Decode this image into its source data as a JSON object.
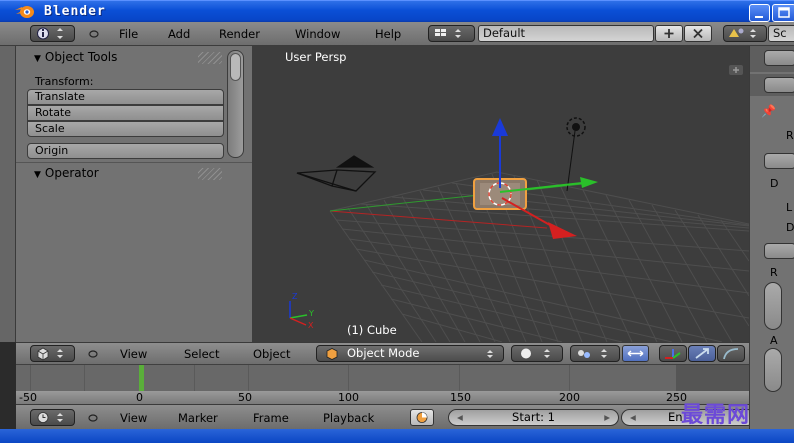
{
  "window": {
    "title": "Blender"
  },
  "info_header": {
    "menus": [
      "File",
      "Add",
      "Render",
      "Window",
      "Help"
    ],
    "screen_layout": "Default",
    "scene": "Sc"
  },
  "toolshelf": {
    "object_tools_title": "Object Tools",
    "transform_label": "Transform:",
    "buttons": [
      "Translate",
      "Rotate",
      "Scale"
    ],
    "origin_button": "Origin",
    "operator_title": "Operator"
  },
  "viewport": {
    "view_label": "User Persp",
    "object_label": "(1) Cube"
  },
  "viewport_header": {
    "menus": [
      "View",
      "Select",
      "Object"
    ],
    "mode": "Object Mode"
  },
  "timeline": {
    "ticks": [
      "-50",
      "0",
      "50",
      "100",
      "150",
      "200",
      "250"
    ],
    "current_frame": 1
  },
  "timeline_header": {
    "menus": [
      "View",
      "Marker",
      "Frame",
      "Playback"
    ],
    "start_field": "Start: 1",
    "end_field": "En"
  },
  "properties": {
    "labels": [
      "R",
      "D",
      "L",
      "D",
      "R",
      "A"
    ]
  },
  "watermark": "最需网",
  "colors": {
    "title_bar": "#0a4fd6",
    "panel_bg": "#727272",
    "viewport_bg": "#3d3d3d",
    "frame_cursor": "#5aae3a",
    "axis_x": "#d42020",
    "axis_y": "#2ac02a",
    "axis_z": "#1a3ad8"
  }
}
